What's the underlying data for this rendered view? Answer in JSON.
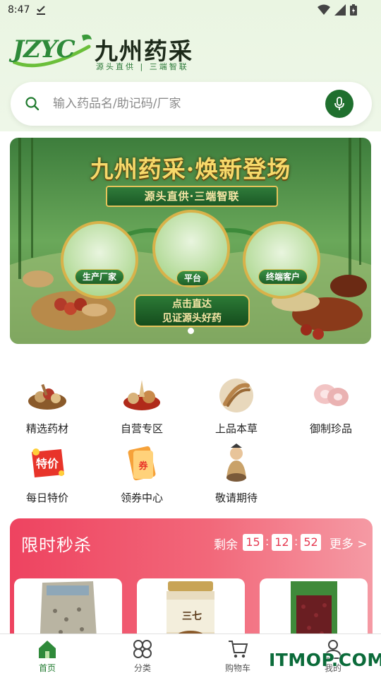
{
  "status_bar": {
    "time": "8:47"
  },
  "header": {
    "logo_mark": "JZYC",
    "logo_name": "九州药采",
    "slogan": "源头直供 | 三端智联"
  },
  "search": {
    "placeholder": "输入药品名/助记码/厂家"
  },
  "banner": {
    "title": "九州药采·焕新登场",
    "ribbon": "源头直供·三端智联",
    "nodes": [
      "生产厂家",
      "平台",
      "终端客户"
    ],
    "cta_line1": "点击直达",
    "cta_line2": "见证源头好药",
    "page_indicator": {
      "current": 1,
      "total": 1
    }
  },
  "categories": [
    {
      "label": "精选药材"
    },
    {
      "label": "自营专区"
    },
    {
      "label": "上品本草"
    },
    {
      "label": "御制珍品"
    },
    {
      "label": "每日特价"
    },
    {
      "label": "领券中心"
    },
    {
      "label": "敬请期待"
    }
  ],
  "flash_sale": {
    "title": "限时秒杀",
    "remain_label": "剩余",
    "hours": "15",
    "minutes": "12",
    "seconds": "52",
    "more_label": "更多 >"
  },
  "tabbar": {
    "items": [
      {
        "label": "首页",
        "active": true
      },
      {
        "label": "分类",
        "active": false
      },
      {
        "label": "购物车",
        "active": false
      },
      {
        "label": "我的",
        "active": false
      }
    ]
  },
  "watermark": "ITMOP.COM",
  "colors": {
    "brand_green": "#1f7a2e",
    "flash_red": "#ee4360"
  }
}
